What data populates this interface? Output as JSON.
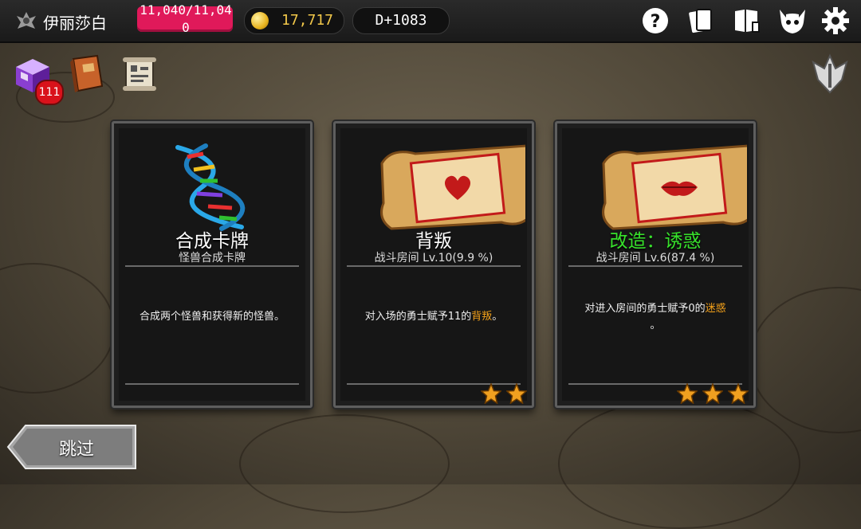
{
  "player": {
    "name": "伊丽莎白",
    "hp": "11,040/11,040",
    "hp_fraction": 1.0
  },
  "currency": {
    "gold": "17,717",
    "day": "D+1083"
  },
  "top_icons": [
    "help-icon",
    "cards-icon",
    "book-icon",
    "demon-icon",
    "gear-icon"
  ],
  "items": {
    "chest_badge": "111"
  },
  "cards": [
    {
      "title": "合成卡牌",
      "subtitle": "怪兽合成卡牌",
      "desc_pre": "合成两个怪兽和获得新的怪兽。",
      "desc_hl": "",
      "desc_post": "",
      "stars": 0,
      "art": "dna-icon"
    },
    {
      "title": "背叛",
      "subtitle": "战斗房间 Lv.10(9.9 %)",
      "desc_pre": "对入场的勇士赋予11的",
      "desc_hl": "背叛",
      "desc_post": "。",
      "stars": 2,
      "art": "heart-scroll-icon"
    },
    {
      "title": "改造：诱惑",
      "subtitle": "战斗房间 Lv.6(87.4 %)",
      "desc_pre": "对进入房间的勇士赋予0的",
      "desc_hl": "迷惑",
      "desc_post": "。",
      "stars": 3,
      "art": "lips-scroll-icon"
    }
  ],
  "skip_label": "跳过",
  "colors": {
    "hp": "#e0195a",
    "gold": "#f2c84a",
    "highlight": "#f5a21a",
    "upgrade_title": "#37e22b"
  }
}
